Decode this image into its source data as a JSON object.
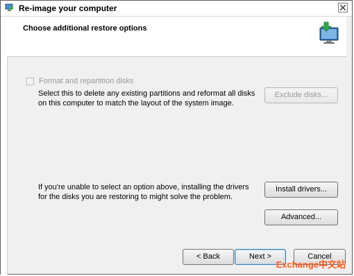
{
  "window": {
    "title": "Re-image your computer"
  },
  "header": {
    "title": "Choose additional restore options",
    "icon": "restore-computer-icon"
  },
  "format_option": {
    "checkbox_label": "Format and repartition disks",
    "checked": false,
    "enabled": false,
    "description_line1": "Select this to delete any existing partitions and reformat all disks",
    "description_line2": "on this computer to match the layout of the system image.",
    "exclude_button_label": "Exclude disks..."
  },
  "drivers": {
    "description_line1": "If you're unable to select an option above, installing the drivers",
    "description_line2": "for the disks you are restoring to might solve the problem.",
    "install_button_label": "Install drivers..."
  },
  "advanced_button_label": "Advanced...",
  "footer": {
    "back_label": "< Back",
    "next_label": "Next >",
    "cancel_label": "Cancel"
  },
  "watermark": "Exchange中文站",
  "colors": {
    "accent": "#3c7fb1",
    "disabled_text": "#9a9a9a",
    "watermark": "#ff5a1a"
  }
}
